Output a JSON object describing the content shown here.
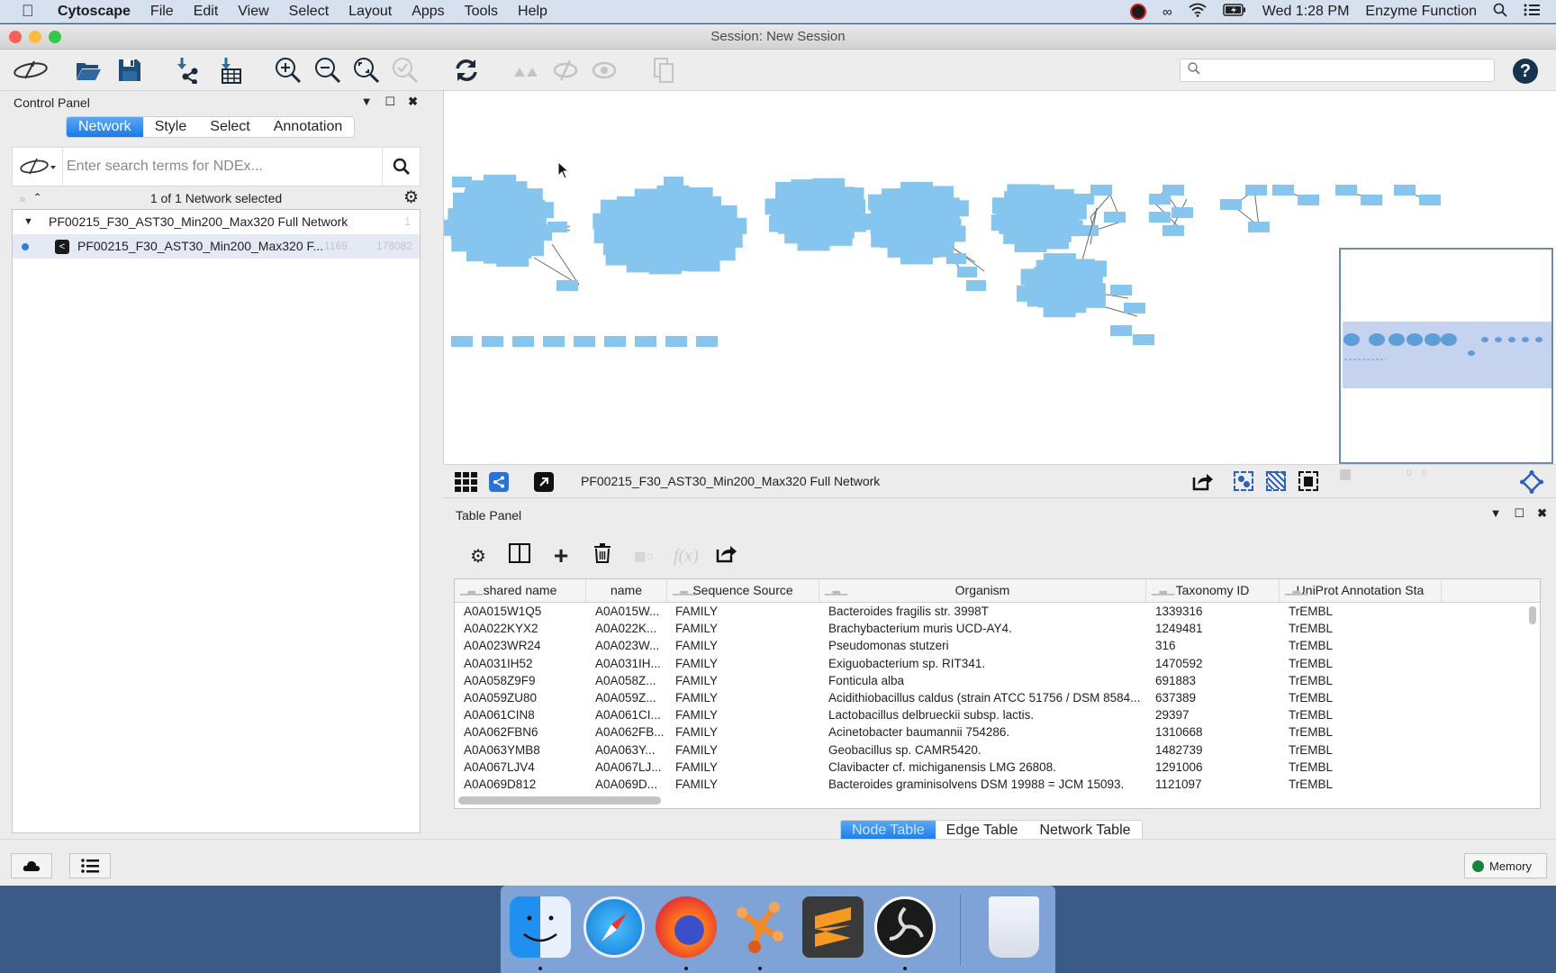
{
  "menubar": {
    "app_name": "Cytoscape",
    "menus": [
      "File",
      "Edit",
      "View",
      "Select",
      "Layout",
      "Apps",
      "Tools",
      "Help"
    ],
    "clock": "Wed 1:28 PM",
    "user": "Enzyme Function"
  },
  "window": {
    "title": "Session: New Session"
  },
  "toolbar": {
    "search_placeholder": "",
    "search_value": ""
  },
  "control_panel": {
    "title": "Control Panel",
    "tabs": [
      {
        "label": "Network",
        "active": true
      },
      {
        "label": "Style",
        "active": false
      },
      {
        "label": "Select",
        "active": false
      },
      {
        "label": "Annotation",
        "active": false
      }
    ],
    "ndex_placeholder": "Enter search terms for NDEx...",
    "selection_status": "1 of 1 Network selected",
    "collections": [
      {
        "name": "PF00215_F30_AST30_Min200_Max320 Full Network",
        "count": "1",
        "networks": [
          {
            "name": "PF00215_F30_AST30_Min200_Max320 F...",
            "nodes": "1169",
            "edges": "178082",
            "selected": true
          }
        ]
      }
    ]
  },
  "network_view": {
    "title": "PF00215_F30_AST30_Min200_Max320 Full Network",
    "node_color": "#86c5ee"
  },
  "table_panel": {
    "title": "Table Panel",
    "columns": [
      "shared name",
      "name",
      "Sequence Source",
      "Organism",
      "Taxonomy ID",
      "UniProt Annotation Sta"
    ],
    "rows": [
      [
        "A0A015W1Q5",
        "A0A015W...",
        "FAMILY",
        "Bacteroides fragilis str. 3998T",
        "1339316",
        "TrEMBL"
      ],
      [
        "A0A022KYX2",
        "A0A022K...",
        "FAMILY",
        "Brachybacterium muris UCD-AY4.",
        "1249481",
        "TrEMBL"
      ],
      [
        "A0A023WR24",
        "A0A023W...",
        "FAMILY",
        "Pseudomonas stutzeri",
        "316",
        "TrEMBL"
      ],
      [
        "A0A031IH52",
        "A0A031IH...",
        "FAMILY",
        "Exiguobacterium sp. RIT341.",
        "1470592",
        "TrEMBL"
      ],
      [
        "A0A058Z9F9",
        "A0A058Z...",
        "FAMILY",
        "Fonticula alba",
        "691883",
        "TrEMBL"
      ],
      [
        "A0A059ZU80",
        "A0A059Z...",
        "FAMILY",
        "Acidithiobacillus caldus  (strain ATCC 51756 / DSM 8584...",
        "637389",
        "TrEMBL"
      ],
      [
        "A0A061CIN8",
        "A0A061CI...",
        "FAMILY",
        "Lactobacillus delbrueckii subsp. lactis.",
        "29397",
        "TrEMBL"
      ],
      [
        "A0A062FBN6",
        "A0A062FB...",
        "FAMILY",
        "Acinetobacter baumannii 754286.",
        "1310668",
        "TrEMBL"
      ],
      [
        "A0A063YMB8",
        "A0A063Y...",
        "FAMILY",
        "Geobacillus sp. CAMR5420.",
        "1482739",
        "TrEMBL"
      ],
      [
        "A0A067LJV4",
        "A0A067LJ...",
        "FAMILY",
        "Clavibacter cf. michiganensis LMG 26808.",
        "1291006",
        "TrEMBL"
      ],
      [
        "A0A069D812",
        "A0A069D...",
        "FAMILY",
        "Bacteroides graminisolvens DSM 19988 = JCM 15093.",
        "1121097",
        "TrEMBL"
      ]
    ],
    "bottom_tabs": [
      {
        "label": "Node Table",
        "active": true
      },
      {
        "label": "Edge Table",
        "active": false
      },
      {
        "label": "Network Table",
        "active": false
      }
    ]
  },
  "statusbar": {
    "memory_label": "Memory",
    "memory_status_color": "#14843a"
  },
  "dock": {
    "apps": [
      "Finder",
      "Safari",
      "Firefox",
      "Cytoscape",
      "Sublime Text",
      "OBS",
      "Trash"
    ]
  }
}
